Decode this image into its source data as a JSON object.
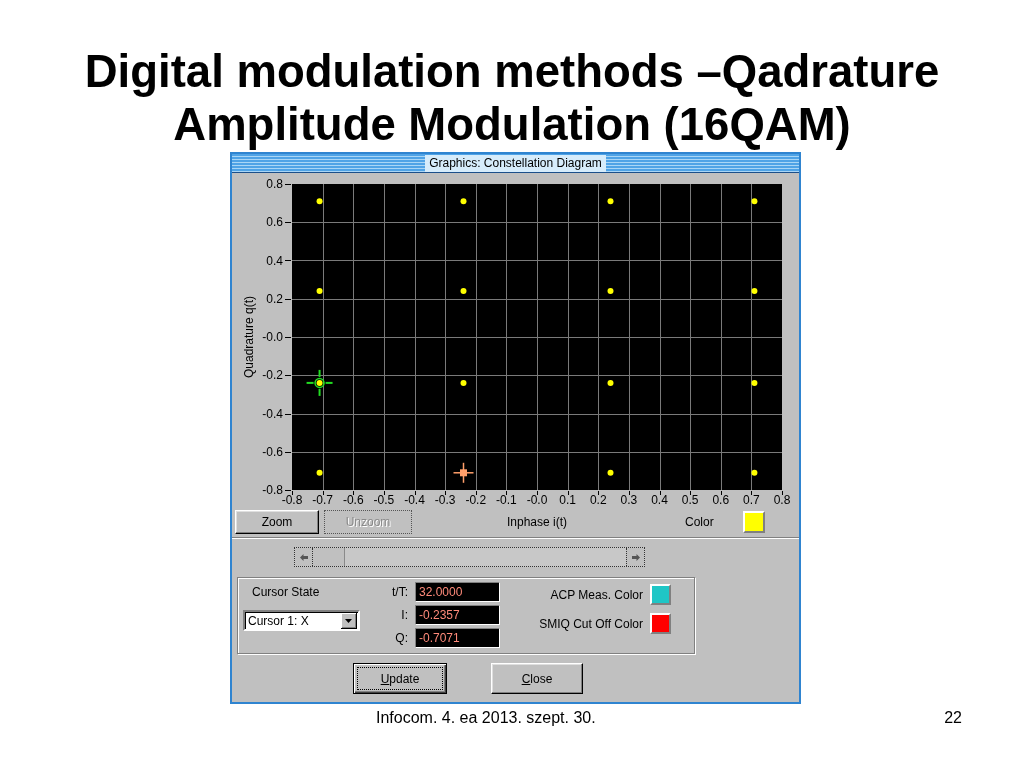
{
  "slide": {
    "title": "Digital modulation methods –Qadrature Amplitude Modulation (16QAM)"
  },
  "window": {
    "title": "Graphics: Constellation Diagram"
  },
  "plot": {
    "chart_data": {
      "type": "scatter",
      "xlabel": "Inphase i(t)",
      "ylabel": "Quadrature q(t)",
      "x": [
        -0.71,
        -0.24,
        0.24,
        0.71,
        -0.71,
        -0.24,
        0.24,
        0.71,
        -0.71,
        -0.24,
        0.24,
        0.71,
        -0.71,
        -0.24,
        0.24,
        0.71
      ],
      "series": [
        {
          "color": "#ffff00",
          "values": [
            0.71,
            0.71,
            0.71,
            0.71,
            0.24,
            0.24,
            0.24,
            0.24,
            -0.24,
            -0.24,
            -0.24,
            -0.24,
            -0.71,
            -0.71,
            -0.71,
            -0.71
          ]
        },
        {
          "color": "#22dd22",
          "values": [
            null,
            null,
            null,
            null,
            null,
            null,
            null,
            null,
            -0.24,
            null,
            null,
            null,
            null,
            null,
            null,
            null
          ]
        },
        {
          "color": "#ff9f6a",
          "values": [
            null,
            null,
            null,
            null,
            null,
            null,
            null,
            null,
            null,
            null,
            null,
            null,
            null,
            -0.71,
            null,
            null
          ]
        }
      ],
      "xlim": [
        -0.8,
        0.8
      ],
      "ylim": [
        -0.8,
        0.8
      ],
      "xticks": [
        -0.8,
        -0.7,
        -0.6,
        -0.5,
        -0.4,
        -0.3,
        -0.2,
        -0.1,
        {
          "value": 0,
          "label": "-0.0"
        },
        0.1,
        0.2,
        0.3,
        0.4,
        0.5,
        0.6,
        0.7,
        0.8
      ],
      "yticks": [
        -0.8,
        -0.6,
        -0.4,
        -0.2,
        {
          "value": 0,
          "label": "-0.0"
        },
        0.2,
        0.4,
        0.6,
        0.8
      ],
      "grid": true
    }
  },
  "plot_controls": {
    "buttons": [
      {
        "label": "Zoom",
        "disabled": false
      },
      {
        "label": "Unzoom",
        "disabled": true
      }
    ],
    "color_label": "Color",
    "color": "#ffff00"
  },
  "cursor_panel": {
    "state_label": "Cursor State",
    "state_select": {
      "value": "Cursor 1: X"
    },
    "readouts": [
      {
        "label": "t/T:",
        "value": "32.0000"
      },
      {
        "label": "I:",
        "value": "-0.2357"
      },
      {
        "label": "Q:",
        "value": "-0.7071"
      }
    ],
    "colors": [
      {
        "label": "ACP Meas. Color",
        "color": "#1fc6c6"
      },
      {
        "label": "SMIQ Cut Off Color",
        "color": "#ff0000"
      }
    ]
  },
  "buttons": [
    {
      "label": "Update",
      "default": true
    },
    {
      "label": "Close",
      "default": false
    }
  ],
  "footer": {
    "text": "Infocom. 4. ea 2013. szept. 30.",
    "page_number": "22"
  }
}
